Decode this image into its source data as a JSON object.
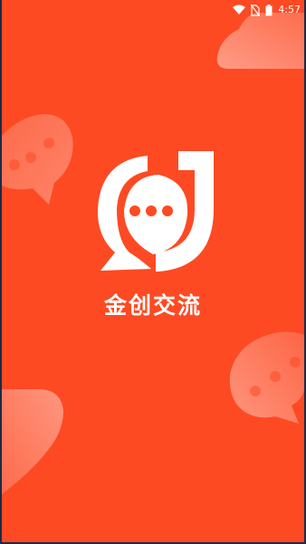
{
  "status_bar": {
    "time": "4:57",
    "icons": [
      "wifi-icon",
      "no-sim-icon",
      "battery-icon"
    ]
  },
  "splash": {
    "app_name": "金创交流",
    "logo_icon": "chat-bubble-j-logo"
  },
  "colors": {
    "background": "#fd4a23",
    "foreground": "#ffffff"
  }
}
